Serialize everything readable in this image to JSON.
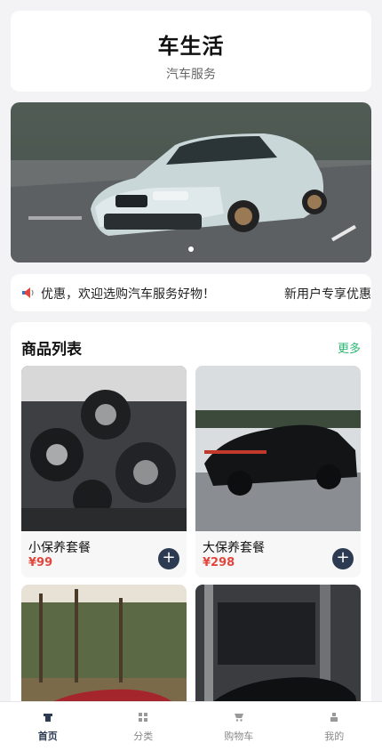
{
  "header": {
    "title": "车生活",
    "subtitle": "汽车服务"
  },
  "notice": {
    "icon": "speaker-icon",
    "text_1": "享优惠，欢迎选购汽车服务好物！",
    "text_2": "新用户专享优惠"
  },
  "goods": {
    "title": "商品列表",
    "more": "更多",
    "items": [
      {
        "name": "小保养套餐",
        "price": "¥99"
      },
      {
        "name": "大保养套餐",
        "price": "¥298"
      },
      {
        "name": "",
        "price": ""
      },
      {
        "name": "",
        "price": ""
      }
    ]
  },
  "tabbar": {
    "tabs": [
      {
        "label": "首页",
        "icon": "home-icon"
      },
      {
        "label": "分类",
        "icon": "grid-icon"
      },
      {
        "label": "购物车",
        "icon": "cart-icon"
      },
      {
        "label": "我的",
        "icon": "user-icon"
      }
    ]
  },
  "colors": {
    "accent": "#2bb673",
    "price": "#e1473d",
    "dark": "#2c3a52"
  }
}
